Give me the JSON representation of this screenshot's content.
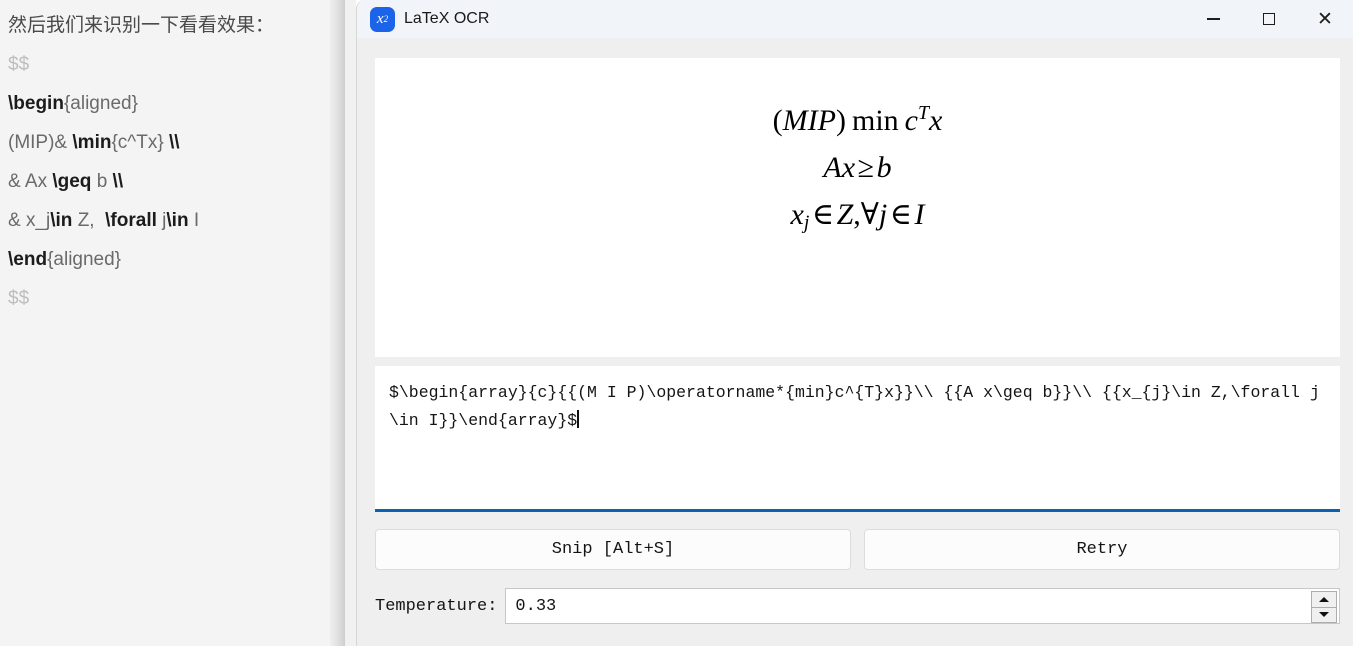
{
  "background_editor": {
    "lines": [
      {
        "id": "l1",
        "segments": [
          {
            "text": "然后我们来识别一下看看效果：",
            "style": "cjk"
          }
        ]
      },
      {
        "id": "l2",
        "segments": [
          {
            "text": "$$",
            "style": "dim"
          }
        ]
      },
      {
        "id": "l3",
        "segments": [
          {
            "text": "\\begin",
            "style": "cmd"
          },
          {
            "text": "{aligned}",
            "style": "plain"
          }
        ]
      },
      {
        "id": "l4",
        "segments": [
          {
            "text": "(MIP)& ",
            "style": "plain"
          },
          {
            "text": "\\min",
            "style": "cmd"
          },
          {
            "text": "{c^Tx} ",
            "style": "plain"
          },
          {
            "text": "\\\\",
            "style": "cmd"
          }
        ]
      },
      {
        "id": "l5",
        "segments": [
          {
            "text": "& Ax ",
            "style": "plain"
          },
          {
            "text": "\\geq",
            "style": "cmd"
          },
          {
            "text": " b ",
            "style": "plain"
          },
          {
            "text": "\\\\",
            "style": "cmd"
          }
        ]
      },
      {
        "id": "l6",
        "segments": [
          {
            "text": "& x_j",
            "style": "plain"
          },
          {
            "text": "\\in",
            "style": "cmd"
          },
          {
            "text": " Z,  ",
            "style": "plain"
          },
          {
            "text": "\\forall",
            "style": "cmd"
          },
          {
            "text": " j",
            "style": "plain"
          },
          {
            "text": "\\in",
            "style": "cmd"
          },
          {
            "text": " I",
            "style": "plain"
          }
        ]
      },
      {
        "id": "l7",
        "segments": [
          {
            "text": "\\end",
            "style": "cmd"
          },
          {
            "text": "{aligned}",
            "style": "plain"
          }
        ]
      },
      {
        "id": "l8",
        "segments": [
          {
            "text": "$$",
            "style": "dim"
          }
        ]
      }
    ]
  },
  "window": {
    "title": "LaTeX OCR",
    "icon_base": "x",
    "icon_sup": "2",
    "controls": {
      "minimize": "Minimize",
      "maximize": "Maximize",
      "close": "Close"
    }
  },
  "formula_preview": {
    "line1": {
      "paren_open": "(",
      "mip": "MIP",
      "paren_close": ")",
      "min": "min",
      "c": "c",
      "c_sup": "T",
      "x": "x"
    },
    "line2": {
      "a": "A",
      "x": "x",
      "rel": "≥",
      "b": "b"
    },
    "line3": {
      "x": "x",
      "x_sub": "j",
      "in1": "∈",
      "z": "Z",
      "comma": ",",
      "forall": "∀",
      "j": "j",
      "in2": "∈",
      "i": "I"
    }
  },
  "source": {
    "latex": "$\\begin{array}{c}{{(M I P)\\operatorname*{min}c^{T}x}}\\\\ {{A x\\geq b}}\\\\ {{x_{j}\\in Z,\\forall j\\in I}}\\end{array}$"
  },
  "actions": {
    "snip_label": "Snip [Alt+S]",
    "retry_label": "Retry"
  },
  "temperature": {
    "label": "Temperature:",
    "value": "0.33"
  },
  "colors": {
    "accent": "#0b62b0",
    "app_icon": "#1b63e8",
    "window_bg": "#efefef",
    "titlebar_bg": "#f1f4f8",
    "panel_bg": "#f4f4f4"
  }
}
